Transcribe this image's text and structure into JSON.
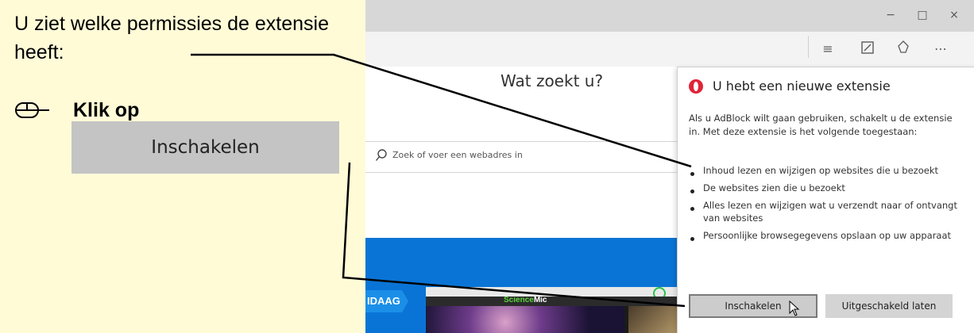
{
  "instructions": {
    "permissions_text": "U ziet welke permissies de extensie heeft:",
    "click_label": "Klik op",
    "button_label": "Inschakelen"
  },
  "browser": {
    "window_controls": {
      "minimize": "−",
      "maximize": "□",
      "close": "×"
    },
    "toolbar_icons": [
      "hub-icon",
      "web-note-icon",
      "share-icon",
      "more-icon"
    ],
    "newtab": {
      "heading": "Wat zoekt u?",
      "search_placeholder": "Zoek of voer een webadres in",
      "today_tag": "IDAAG",
      "thumbnail_brand_green": "Science",
      "thumbnail_brand_white": "Mic"
    },
    "extension_popup": {
      "title": "U hebt een nieuwe extensie",
      "description": "Als u AdBlock wilt gaan gebruiken, schakelt u de extensie in. Met deze extensie is het volgende toegestaan:",
      "permissions": [
        "Inhoud lezen en wijzigen op websites die u bezoekt",
        "De websites zien die u bezoekt",
        "Alles lezen en wijzigen wat u verzendt naar of ontvangt van websites",
        "Persoonlijke browsegegevens opslaan op uw apparaat"
      ],
      "enable_button": "Inschakelen",
      "keep_disabled_button": "Uitgeschakeld laten"
    }
  },
  "colors": {
    "instruction_background": "#fffbd7",
    "mock_button": "#c4c4c4",
    "opera_red": "#e0243a",
    "blue_band": "#0a74d6"
  }
}
